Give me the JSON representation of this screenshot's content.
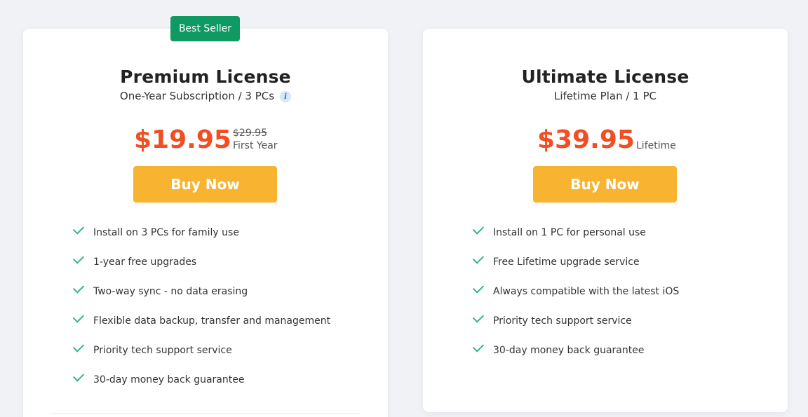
{
  "premium": {
    "badge": "Best Seller",
    "title": "Premium License",
    "subtitle": "One-Year Subscription / 3 PCs",
    "price": "$19.95",
    "old_price": "$29.95",
    "price_note": "First Year",
    "buy_label": "Buy Now",
    "features": [
      "Install on 3 PCs for family use",
      "1-year free upgrades",
      "Two-way sync - no data erasing",
      "Flexible data backup, transfer and management",
      "Priority tech support service",
      "30-day money back guarantee"
    ]
  },
  "ultimate": {
    "title": "Ultimate License",
    "subtitle": "Lifetime Plan / 1 PC",
    "price": "$39.95",
    "price_note": "Lifetime",
    "buy_label": "Buy Now",
    "features": [
      "Install on 1 PC for personal use",
      "Free Lifetime upgrade service",
      "Always compatible with the latest iOS",
      "Priority tech support service",
      "30-day money back guarantee"
    ]
  },
  "icons": {
    "info": "info-icon",
    "check": "check-icon"
  },
  "colors": {
    "badge": "#0f9a63",
    "price": "#f04e23",
    "button": "#f8b431",
    "check": "#2fb586",
    "background": "#f0f2f5"
  }
}
